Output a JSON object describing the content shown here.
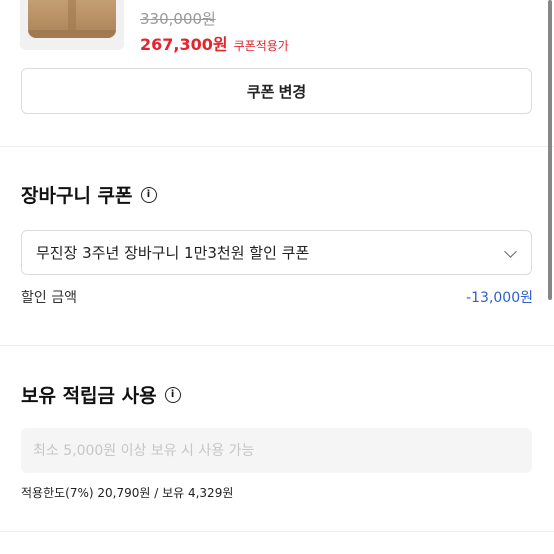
{
  "product": {
    "original_price": "330,000원",
    "sale_price": "267,300원",
    "coupon_tag": "쿠폰적용가"
  },
  "coupon_change_button": "쿠폰 변경",
  "cart_coupon": {
    "title": "장바구니 쿠폰",
    "info_icon": "info-icon",
    "selected_option": "무진장 3주년 장바구니 1만3천원 할인 쿠폰",
    "discount_label": "할인 금액",
    "discount_amount": "-13,000원"
  },
  "points": {
    "title": "보유 적립금 사용",
    "info_icon": "info-icon",
    "input_placeholder": "최소 5,000원 이상 보유 시 사용 가능",
    "limit_text": "적용한도(7%) 20,790원 / 보유 4,329원"
  },
  "colors": {
    "sale_red": "#e1252d",
    "discount_blue": "#2f5fcf"
  }
}
